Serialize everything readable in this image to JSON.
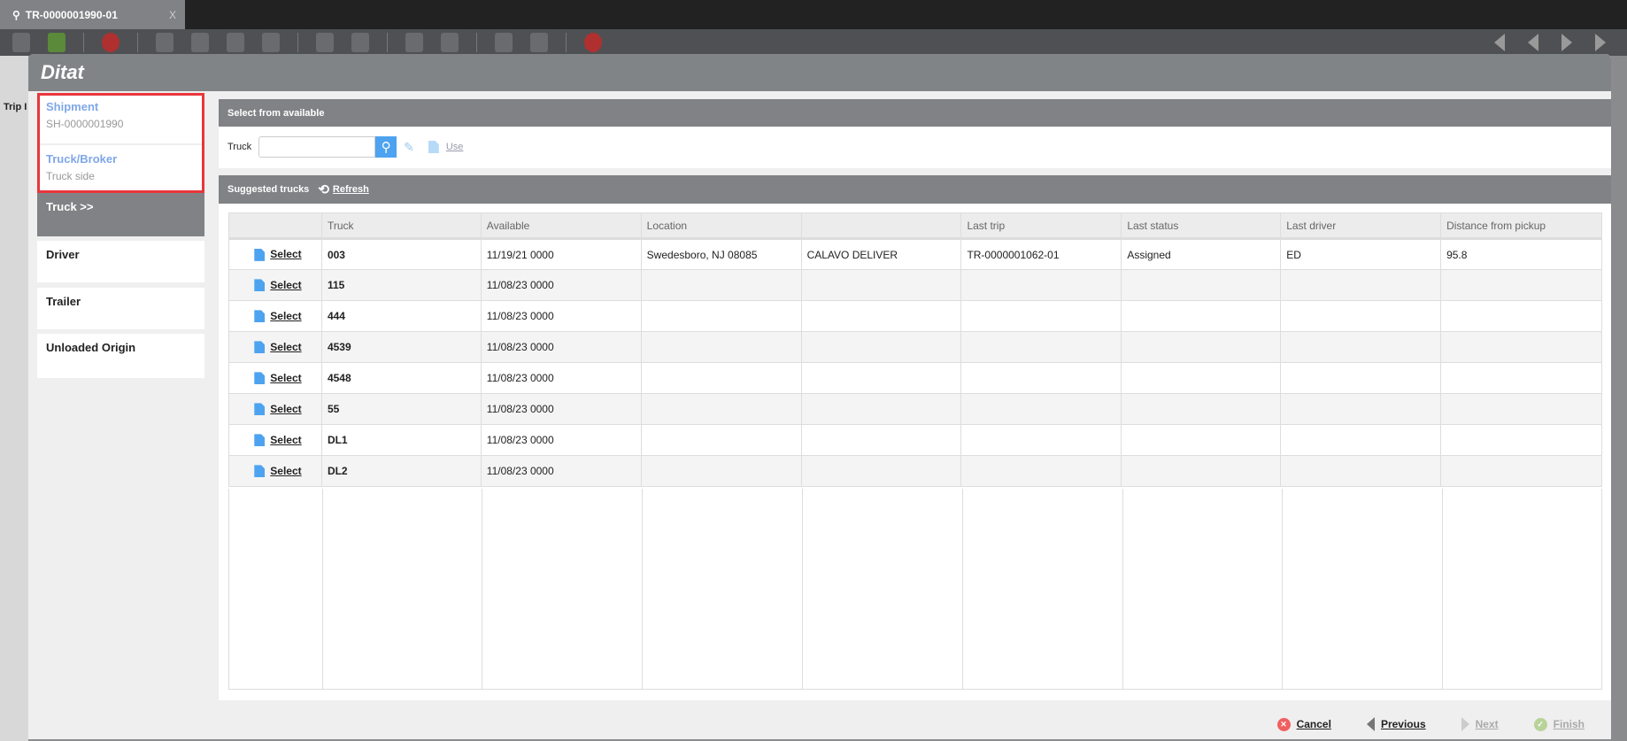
{
  "tab": {
    "title": "TR-0000001990-01",
    "close": "X"
  },
  "underlying": {
    "label": "Trip I"
  },
  "logo": "Ditat",
  "steps": [
    {
      "title": "Shipment",
      "sub": "SH-0000001990"
    },
    {
      "title": "Truck/Broker",
      "sub": "Truck side"
    },
    {
      "title": "Truck >>"
    },
    {
      "title": "Driver"
    },
    {
      "title": "Trailer"
    },
    {
      "title": "Unloaded Origin"
    }
  ],
  "select_panel": {
    "title": "Select from available",
    "truck_label": "Truck",
    "truck_value": "",
    "use_label": "Use"
  },
  "suggested": {
    "title": "Suggested trucks",
    "refresh_label": "Refresh"
  },
  "table": {
    "headers": [
      "",
      "Truck",
      "Available",
      "Location",
      "",
      "Last trip",
      "Last status",
      "Last driver",
      "Distance from pickup"
    ],
    "select_label": "Select",
    "rows": [
      [
        "003",
        "11/19/21 0000",
        "Swedesboro, NJ 08085",
        "CALAVO DELIVER",
        "TR-0000001062-01",
        "Assigned",
        "ED",
        "95.8"
      ],
      [
        "115",
        "11/08/23 0000",
        "",
        "",
        "",
        "",
        "",
        ""
      ],
      [
        "444",
        "11/08/23 0000",
        "",
        "",
        "",
        "",
        "",
        ""
      ],
      [
        "4539",
        "11/08/23 0000",
        "",
        "",
        "",
        "",
        "",
        ""
      ],
      [
        "4548",
        "11/08/23 0000",
        "",
        "",
        "",
        "",
        "",
        ""
      ],
      [
        "55",
        "11/08/23 0000",
        "",
        "",
        "",
        "",
        "",
        ""
      ],
      [
        "DL1",
        "11/08/23 0000",
        "",
        "",
        "",
        "",
        "",
        ""
      ],
      [
        "DL2",
        "11/08/23 0000",
        "",
        "",
        "",
        "",
        "",
        ""
      ]
    ]
  },
  "footer": {
    "cancel": "Cancel",
    "previous": "Previous",
    "next": "Next",
    "finish": "Finish"
  },
  "colors": {
    "accent": "#4da3f0",
    "highlight": "#e8363c"
  }
}
